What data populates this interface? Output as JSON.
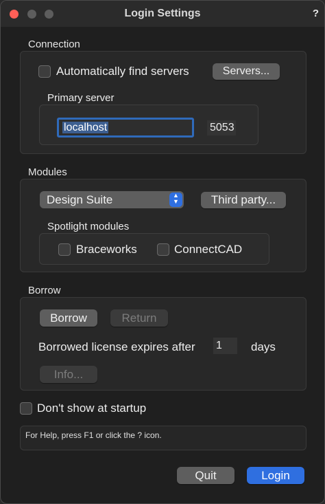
{
  "window": {
    "title": "Login Settings",
    "help_label": "?"
  },
  "connection": {
    "section_label": "Connection",
    "auto_find_label": "Automatically find servers",
    "auto_find_checked": false,
    "servers_button": "Servers...",
    "primary_server_label": "Primary server",
    "host_value": "localhost",
    "port_value": "5053"
  },
  "modules": {
    "section_label": "Modules",
    "selected_module": "Design Suite",
    "third_party_button": "Third party...",
    "spotlight_label": "Spotlight modules",
    "braceworks_label": "Braceworks",
    "braceworks_checked": false,
    "connectcad_label": "ConnectCAD",
    "connectcad_checked": false
  },
  "borrow": {
    "section_label": "Borrow",
    "borrow_button": "Borrow",
    "return_button": "Return",
    "expires_label": "Borrowed license expires after",
    "days_value": "1",
    "days_label": "days",
    "info_button": "Info..."
  },
  "startup": {
    "dont_show_label": "Don't show at startup",
    "dont_show_checked": false
  },
  "status_text": "For Help, press F1 or click the ? icon.",
  "footer": {
    "quit_button": "Quit",
    "login_button": "Login"
  },
  "colors": {
    "accent": "#2f6fe0",
    "close_button": "#ff5f57"
  }
}
